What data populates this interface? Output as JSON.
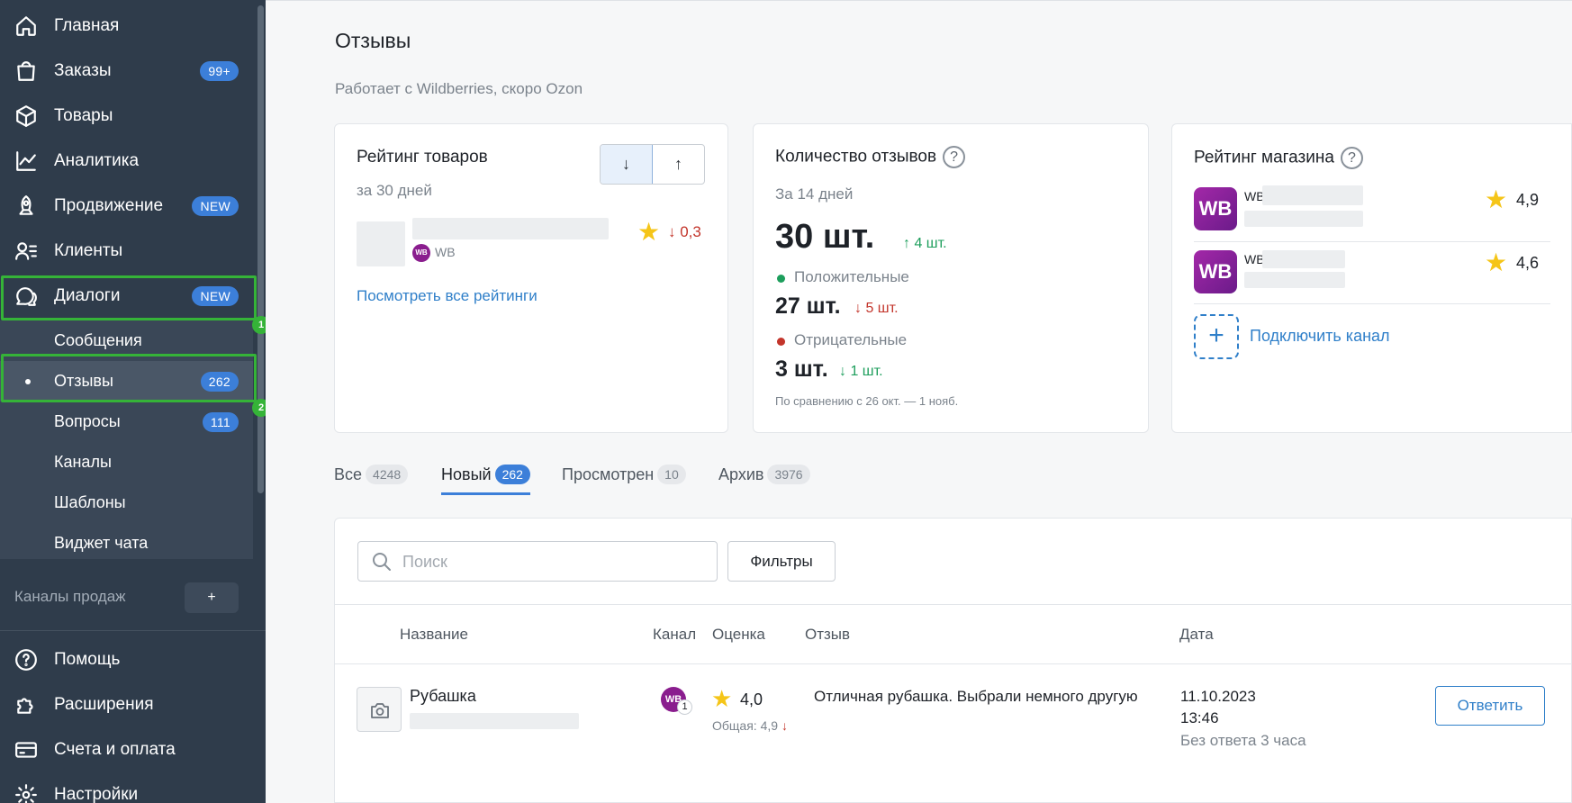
{
  "sidebar": {
    "nav": [
      {
        "label": "Главная",
        "icon": "home-icon"
      },
      {
        "label": "Заказы",
        "icon": "shopping-bag-icon",
        "badge": "99+"
      },
      {
        "label": "Товары",
        "icon": "box-icon"
      },
      {
        "label": "Аналитика",
        "icon": "chart-line-icon"
      },
      {
        "label": "Продвижение",
        "icon": "rocket-icon",
        "badge": "NEW"
      },
      {
        "label": "Клиенты",
        "icon": "clients-icon"
      },
      {
        "label": "Диалоги",
        "icon": "chat-bubbles-icon",
        "badge": "NEW"
      }
    ],
    "submenu": [
      {
        "label": "Сообщения"
      },
      {
        "label": "Отзывы",
        "badge": "262"
      },
      {
        "label": "Вопросы",
        "badge": "111"
      },
      {
        "label": "Каналы"
      },
      {
        "label": "Шаблоны"
      },
      {
        "label": "Виджет чата"
      }
    ],
    "steps": [
      "1",
      "2"
    ],
    "channels_label": "Каналы продаж",
    "channels_add": "+",
    "bottom": [
      {
        "label": "Помощь",
        "icon": "help-circle-icon"
      },
      {
        "label": "Расширения",
        "icon": "puzzle-icon"
      },
      {
        "label": "Счета и оплата",
        "icon": "credit-card-icon"
      },
      {
        "label": "Настройки",
        "icon": "gear-icon"
      }
    ]
  },
  "page": {
    "title": "Отзывы",
    "subtitle": "Работает с Wildberries, скоро Ozon"
  },
  "rating_card": {
    "title": "Рейтинг товаров",
    "period": "за 30 дней",
    "sort_down": "↓",
    "sort_up": "↑",
    "channel": "WB",
    "channel_logo": "WB",
    "delta": "↓ 0,3",
    "link": "Посмотреть все рейтинги"
  },
  "count_card": {
    "title": "Количество отзывов",
    "help": "?",
    "period": "За 14 дней",
    "total": "30 шт.",
    "total_delta": "↑ 4 шт.",
    "positive_label": "Положительные",
    "positive_value": "27 шт.",
    "positive_delta": "↓ 5 шт.",
    "negative_label": "Отрицательные",
    "negative_value": "3 шт.",
    "negative_delta": "↓ 1 шт.",
    "compare_note": "По сравнению с 26 окт. — 1 нояб."
  },
  "store_card": {
    "title": "Рейтинг магазина",
    "help": "?",
    "stores": [
      {
        "logo": "WB",
        "name": "WB",
        "rating": "4,9"
      },
      {
        "logo": "WB",
        "name": "WB",
        "rating": "4,6"
      }
    ],
    "add_icon": "+",
    "connect": "Подключить канал"
  },
  "tabs": [
    {
      "label": "Все",
      "count": "4248"
    },
    {
      "label": "Новый",
      "count": "262",
      "active": true
    },
    {
      "label": "Просмотрен",
      "count": "10"
    },
    {
      "label": "Архив",
      "count": "3976"
    }
  ],
  "table": {
    "search_placeholder": "Поиск",
    "filters": "Фильтры",
    "headers": {
      "name": "Название",
      "channel": "Канал",
      "rating": "Оценка",
      "review": "Отзыв",
      "date": "Дата"
    },
    "rows": [
      {
        "name": "Рубашка",
        "channel_logo": "WB",
        "channel_count": "1",
        "rating": "4,0",
        "overall": "Общая: 4,9",
        "overall_trend": "↓",
        "review": "Отличная рубашка. Выбрали немного другую",
        "date": "11.10.2023",
        "time": "13:46",
        "status": "Без ответа 3 часа",
        "action": "Ответить"
      }
    ]
  },
  "colors": {
    "sidebar_bg": "#2f3c4b",
    "accent": "#3c7fd9",
    "highlight": "#35b338",
    "star": "#f5c518",
    "negative": "#c3352b",
    "positive": "#1d9e5c",
    "wb_brand": "#8a1d8e"
  }
}
